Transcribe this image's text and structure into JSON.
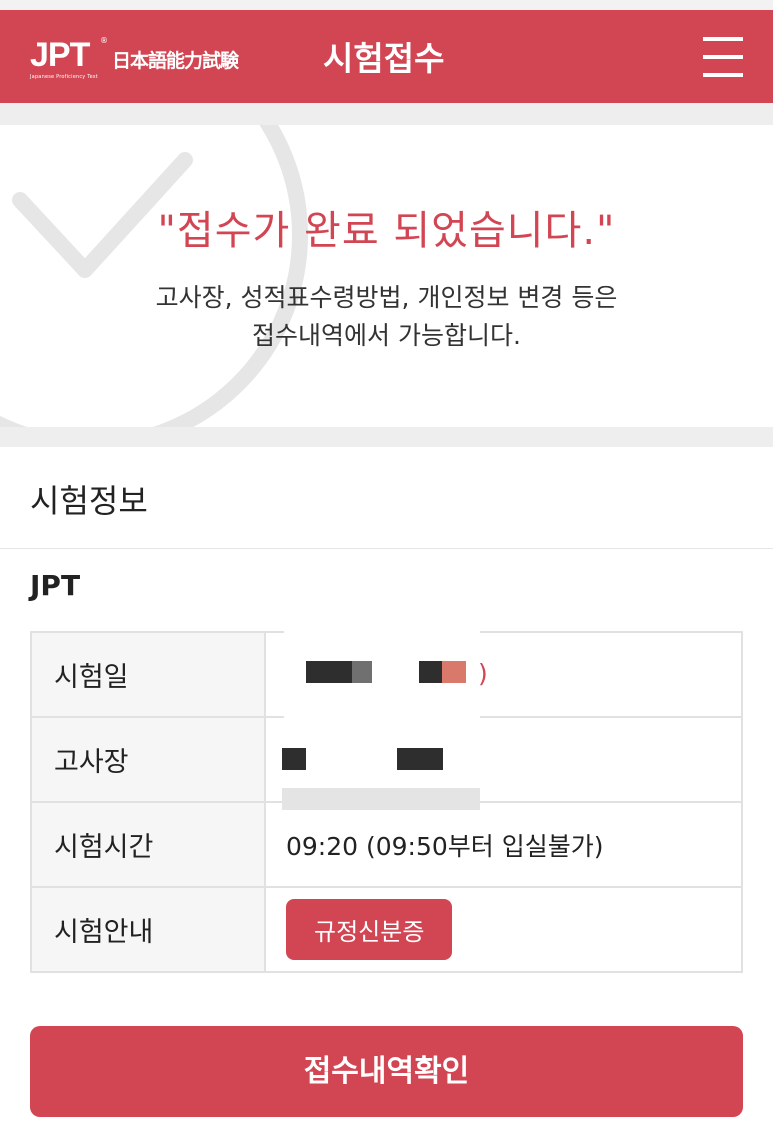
{
  "header": {
    "logo_text": "JPT",
    "logo_kanji": "日本語能力試験",
    "logo_sub": "Japanese Proficiency Test",
    "title": "시험접수",
    "menu_icon": "hamburger-menu-icon"
  },
  "banner": {
    "title": "\"접수가 완료 되었습니다.\"",
    "desc_line1": "고사장, 성적표수령방법, 개인정보 변경 등은",
    "desc_line2": "접수내역에서 가능합니다.",
    "bg_icon": "checkmark-circle-icon"
  },
  "exam_info": {
    "section_title": "시험정보",
    "exam_name": "JPT",
    "rows": [
      {
        "label": "시험일",
        "value": ")"
      },
      {
        "label": "고사장",
        "value": ""
      },
      {
        "label": "시험시간",
        "value": "09:20 (09:50부터 입실불가)"
      },
      {
        "label": "시험안내",
        "value": ""
      }
    ],
    "guide_button": "규정신분증"
  },
  "confirm_button": "접수내역확인",
  "colors": {
    "brand_red": "#d24553",
    "gray_bg": "#eeeeee",
    "table_header_bg": "#f6f6f6"
  }
}
